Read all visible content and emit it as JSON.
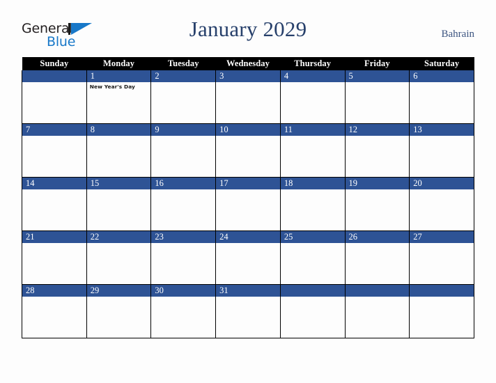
{
  "brand": {
    "word_one": "General",
    "word_two": "Blue",
    "mark": "triangle-logo",
    "accent_color": "#1878c8"
  },
  "header": {
    "title": "January 2029",
    "region": "Bahrain",
    "title_color": "#27406b"
  },
  "calendar": {
    "month": "January",
    "year": "2029",
    "weekday_headers": [
      "Sunday",
      "Monday",
      "Tuesday",
      "Wednesday",
      "Thursday",
      "Friday",
      "Saturday"
    ],
    "header_bg": "#000000",
    "daynum_band_color": "#2e5395",
    "weeks": [
      [
        {
          "day": "",
          "events": []
        },
        {
          "day": "1",
          "events": [
            "New Year's Day"
          ]
        },
        {
          "day": "2",
          "events": []
        },
        {
          "day": "3",
          "events": []
        },
        {
          "day": "4",
          "events": []
        },
        {
          "day": "5",
          "events": []
        },
        {
          "day": "6",
          "events": []
        }
      ],
      [
        {
          "day": "7",
          "events": []
        },
        {
          "day": "8",
          "events": []
        },
        {
          "day": "9",
          "events": []
        },
        {
          "day": "10",
          "events": []
        },
        {
          "day": "11",
          "events": []
        },
        {
          "day": "12",
          "events": []
        },
        {
          "day": "13",
          "events": []
        }
      ],
      [
        {
          "day": "14",
          "events": []
        },
        {
          "day": "15",
          "events": []
        },
        {
          "day": "16",
          "events": []
        },
        {
          "day": "17",
          "events": []
        },
        {
          "day": "18",
          "events": []
        },
        {
          "day": "19",
          "events": []
        },
        {
          "day": "20",
          "events": []
        }
      ],
      [
        {
          "day": "21",
          "events": []
        },
        {
          "day": "22",
          "events": []
        },
        {
          "day": "23",
          "events": []
        },
        {
          "day": "24",
          "events": []
        },
        {
          "day": "25",
          "events": []
        },
        {
          "day": "26",
          "events": []
        },
        {
          "day": "27",
          "events": []
        }
      ],
      [
        {
          "day": "28",
          "events": []
        },
        {
          "day": "29",
          "events": []
        },
        {
          "day": "30",
          "events": []
        },
        {
          "day": "31",
          "events": []
        },
        {
          "day": "",
          "events": []
        },
        {
          "day": "",
          "events": []
        },
        {
          "day": "",
          "events": []
        }
      ]
    ]
  }
}
